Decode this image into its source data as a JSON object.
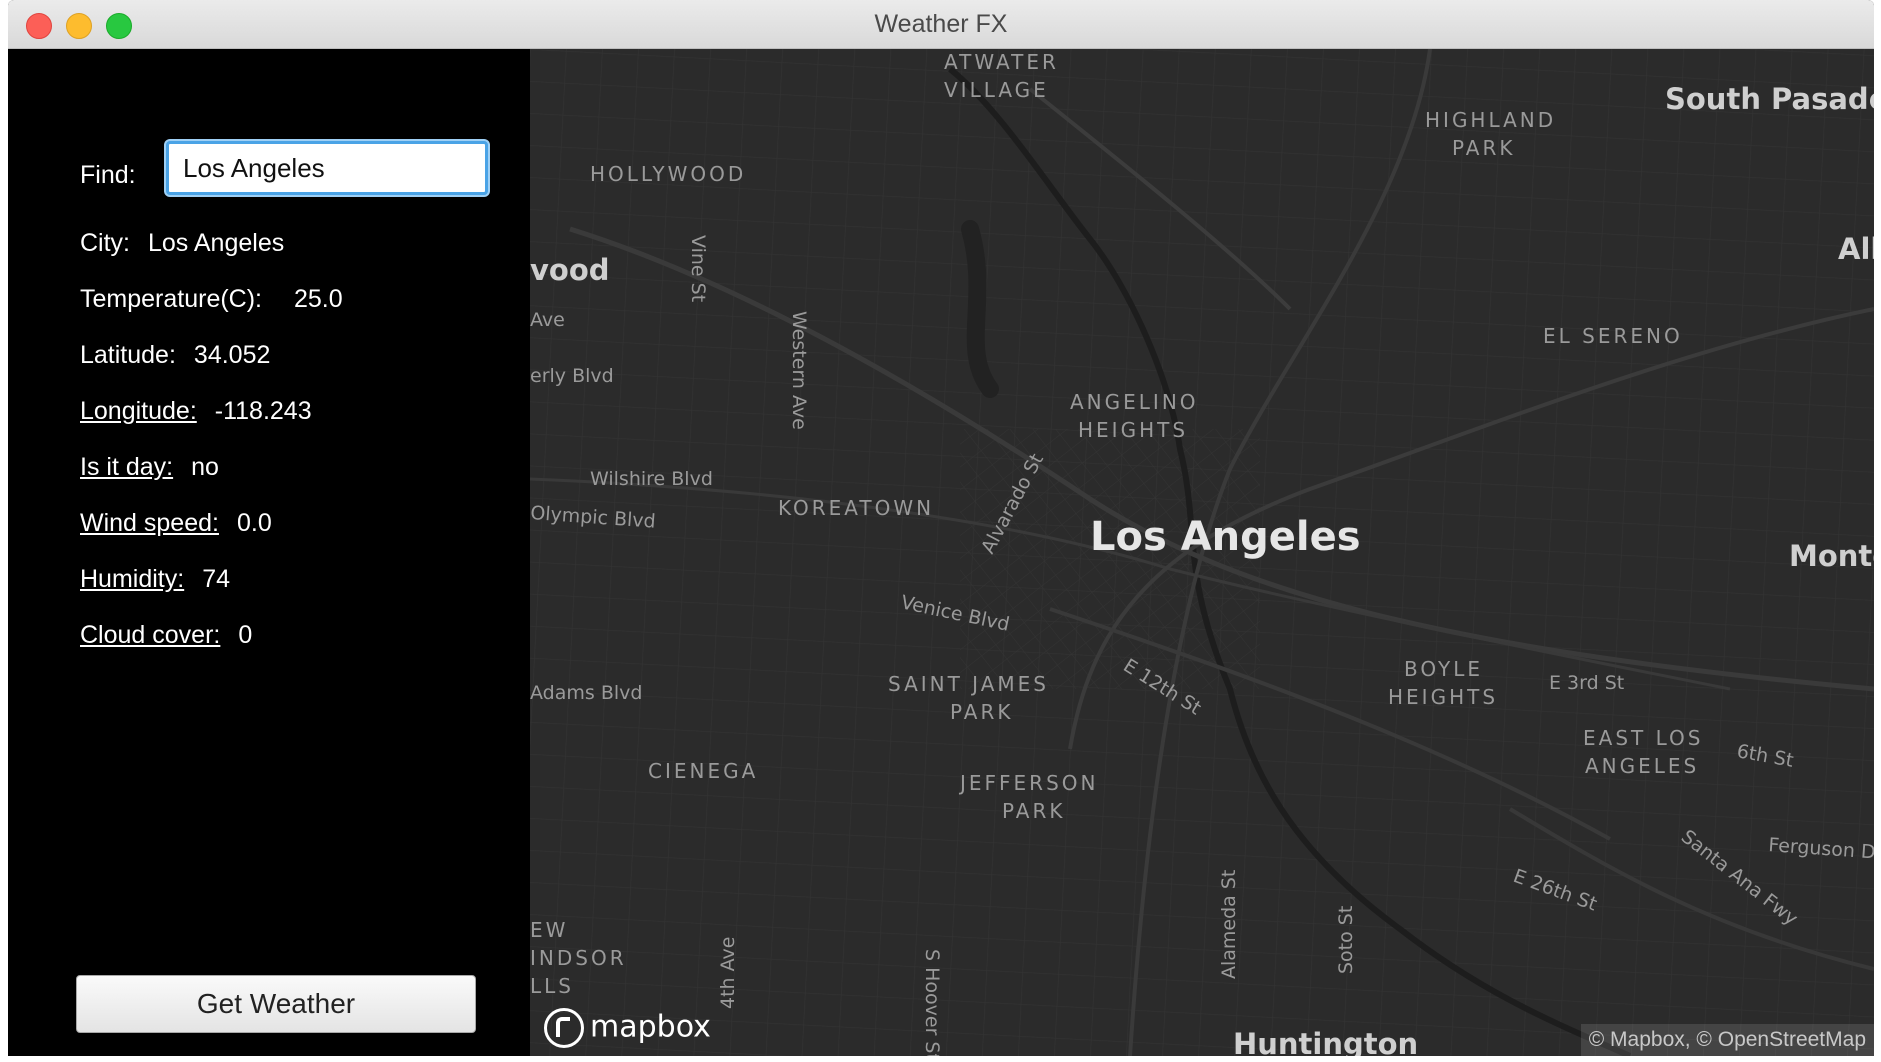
{
  "window": {
    "title": "Weather FX"
  },
  "sidebar": {
    "find_label": "Find:",
    "find_value": "Los Angeles",
    "rows": [
      {
        "label": "City:",
        "value": "Los Angeles",
        "link": false
      },
      {
        "label": "Temperature(C):",
        "value": "25.0",
        "link": false
      },
      {
        "label": "Latitude:",
        "value": "34.052",
        "link": false
      },
      {
        "label": "Longitude:",
        "value": "-118.243",
        "link": true
      },
      {
        "label": "Is it day:",
        "value": "no",
        "link": true
      },
      {
        "label": "Wind speed:",
        "value": "0.0",
        "link": true
      },
      {
        "label": "Humidity:",
        "value": "74",
        "link": true
      },
      {
        "label": "Cloud cover:",
        "value": "0",
        "link": true
      }
    ],
    "button_label": "Get Weather"
  },
  "map": {
    "city_label": "Los Angeles",
    "attribution": "© Mapbox, © OpenStreetMap",
    "logo": "mapbox",
    "labels": {
      "atwater": "ATWATER",
      "village": "VILLAGE",
      "highland": "HIGHLAND",
      "park": "PARK",
      "south_pasadena": "South Pasade",
      "alhambra": "Alh",
      "hollywood_district": "HOLLYWOOD",
      "hollywood": "vood",
      "ave": "Ave",
      "beverly": "erly Blvd",
      "el_sereno": "EL SERENO",
      "angelino": "ANGELINO",
      "heights": "HEIGHTS",
      "wilshire": "Wilshire Blvd",
      "koreatown": "KOREATOWN",
      "olympic": "Olympic Blvd",
      "alvarado": "Alvarado St",
      "monterey": "Monte",
      "venice": "Venice Blvd",
      "boyle": "BOYLE",
      "e3rd": "E 3rd St",
      "e12th": "E 12th St",
      "adams": "Adams Blvd",
      "saint_james": "SAINT JAMES",
      "east_los": "EAST LOS",
      "angeles_caps": "ANGELES",
      "sixth": "6th St",
      "cienega": "CIENEGA",
      "jefferson": "JEFFERSON",
      "santa_ana": "Santa Ana Fwy",
      "ferguson": "Ferguson D",
      "e26th": "E 26th St",
      "alameda": "Alameda St",
      "soto": "Soto St",
      "vine": "Vine St",
      "western": "Western Ave",
      "view": "EW",
      "windsor": "INDSOR",
      "hills": "LLS",
      "fourth_ave": "4th Ave",
      "hoover": "S Hoover St",
      "huntington": "Huntington"
    }
  }
}
